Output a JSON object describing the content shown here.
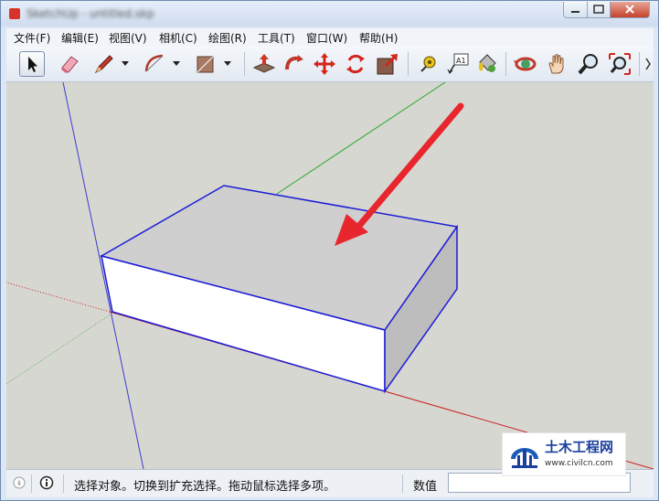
{
  "window": {
    "title": "SketchUp - untitled.skp"
  },
  "titlebar": {
    "minimize_icon": "minimize-icon",
    "maximize_icon": "maximize-icon",
    "close_icon": "close-icon"
  },
  "menu": [
    {
      "label": "文件(F)"
    },
    {
      "label": "编辑(E)"
    },
    {
      "label": "视图(V)"
    },
    {
      "label": "相机(C)"
    },
    {
      "label": "绘图(R)"
    },
    {
      "label": "工具(T)"
    },
    {
      "label": "窗口(W)"
    },
    {
      "label": "帮助(H)"
    }
  ],
  "toolbar": {
    "tools": [
      "select-icon",
      "eraser-icon",
      "pencil-icon",
      "arc-icon",
      "rectangle-icon",
      "push-pull-icon",
      "follow-me-icon",
      "move-icon",
      "rotate-icon",
      "scale-icon",
      "tape-measure-icon",
      "text-icon",
      "paint-bucket-icon",
      "orbit-icon",
      "pan-icon",
      "zoom-icon",
      "zoom-extents-icon"
    ],
    "text_tool_glyph": "A1"
  },
  "viewport": {
    "background": "#d6d7d1",
    "selection_color": "#1b1bd6",
    "box_face": "#cfcfcf",
    "front_face": "#ffffff",
    "side_face": "#bdbdbd",
    "arrow_color": "#e8262e"
  },
  "status": {
    "message": "选择对象。切换到扩充选择。拖动鼠标选择多项。",
    "measurement_label": "数值",
    "measurement_value": ""
  },
  "watermark": {
    "title": "土木工程网",
    "url": "www.civilcn.com"
  }
}
